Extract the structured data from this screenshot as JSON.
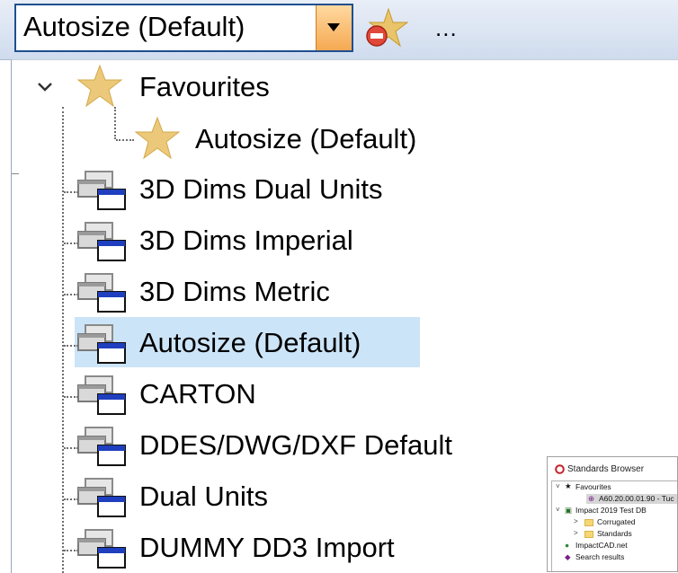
{
  "toolbar": {
    "combo_value": "Autosize (Default)",
    "dropdown_icon": "dropdown-arrow-icon",
    "favourite_remove_icon": "remove-favourite-icon",
    "more_label": "..."
  },
  "tree": {
    "favourites": {
      "label": "Favourites",
      "expanded": true,
      "icon": "star-icon",
      "children": [
        {
          "label": "Autosize (Default)",
          "icon": "star-icon"
        }
      ]
    },
    "standards": [
      {
        "label": "3D Dims Dual Units",
        "icon": "standard-window-icon"
      },
      {
        "label": "3D Dims Imperial",
        "icon": "standard-window-icon"
      },
      {
        "label": "3D Dims Metric",
        "icon": "standard-window-icon"
      },
      {
        "label": "Autosize (Default)",
        "icon": "standard-window-icon",
        "selected": true
      },
      {
        "label": "CARTON",
        "icon": "standard-window-icon"
      },
      {
        "label": "DDES/DWG/DXF Default",
        "icon": "standard-window-icon"
      },
      {
        "label": "Dual Units",
        "icon": "standard-window-icon"
      },
      {
        "label": "DUMMY DD3 Import",
        "icon": "standard-window-icon"
      }
    ],
    "selection_color": "#cce4f7"
  },
  "mini_browser": {
    "title": "Standards Browser",
    "rows": {
      "favourites": "Favourites",
      "fav_item": "A60.20.00.01.90 - Tuc",
      "db": "Impact 2019 Test DB",
      "corrugated": "Corrugated",
      "standards": "Standards",
      "impactcad": "ImpactCAD.net",
      "search": "Search results"
    }
  }
}
